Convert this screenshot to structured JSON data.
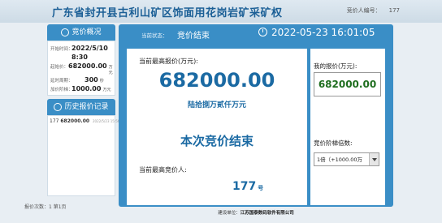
{
  "header": {
    "title": "广东省封开县古利山矿区饰面用花岗岩矿采矿权",
    "bidder_label": "竞价人编号：",
    "bidder_number": "177"
  },
  "overview": {
    "panel_title": "竞价概况",
    "start_time_label": "开始时间：",
    "start_date": "2022/5/10",
    "start_time": "8:30",
    "start_price_label": "起始价：",
    "start_price": "682000.00",
    "start_price_unit": "万元",
    "delay_label": "延时周期：",
    "delay_value": "300",
    "delay_unit": "秒",
    "step_label": "加价阶梯：",
    "step_value": "1000.00",
    "step_unit": "万元"
  },
  "history": {
    "panel_title": "历史报价记录",
    "records": [
      {
        "bidder": "177",
        "amount": "682000.00",
        "time": "2022/5/23 15:56:55"
      }
    ],
    "page_info": "报价次数：1    第1页"
  },
  "status": {
    "label": "当前状态：",
    "value": "竞价结束",
    "datetime": "2022-05-23 16:01:05"
  },
  "center": {
    "highest_label": "当前最高报价(万元):",
    "highest_price": "682000.00",
    "highest_words": "陆拾捌万贰仟万元",
    "end_message": "本次竞价结束",
    "highest_bidder_label": "当前最高竞价人:",
    "highest_bidder": "177",
    "highest_bidder_suffix": "号"
  },
  "my_bid": {
    "label": "我的报价(万元):",
    "value": "682000.00",
    "step_multiple_label": "竞价阶梯倍数:",
    "step_multiple_selected": "1倍（+1000.00万"
  },
  "footer": {
    "sponsor_label": "建设单位：",
    "sponsor": "江苏国泰数码软件有限公司"
  }
}
